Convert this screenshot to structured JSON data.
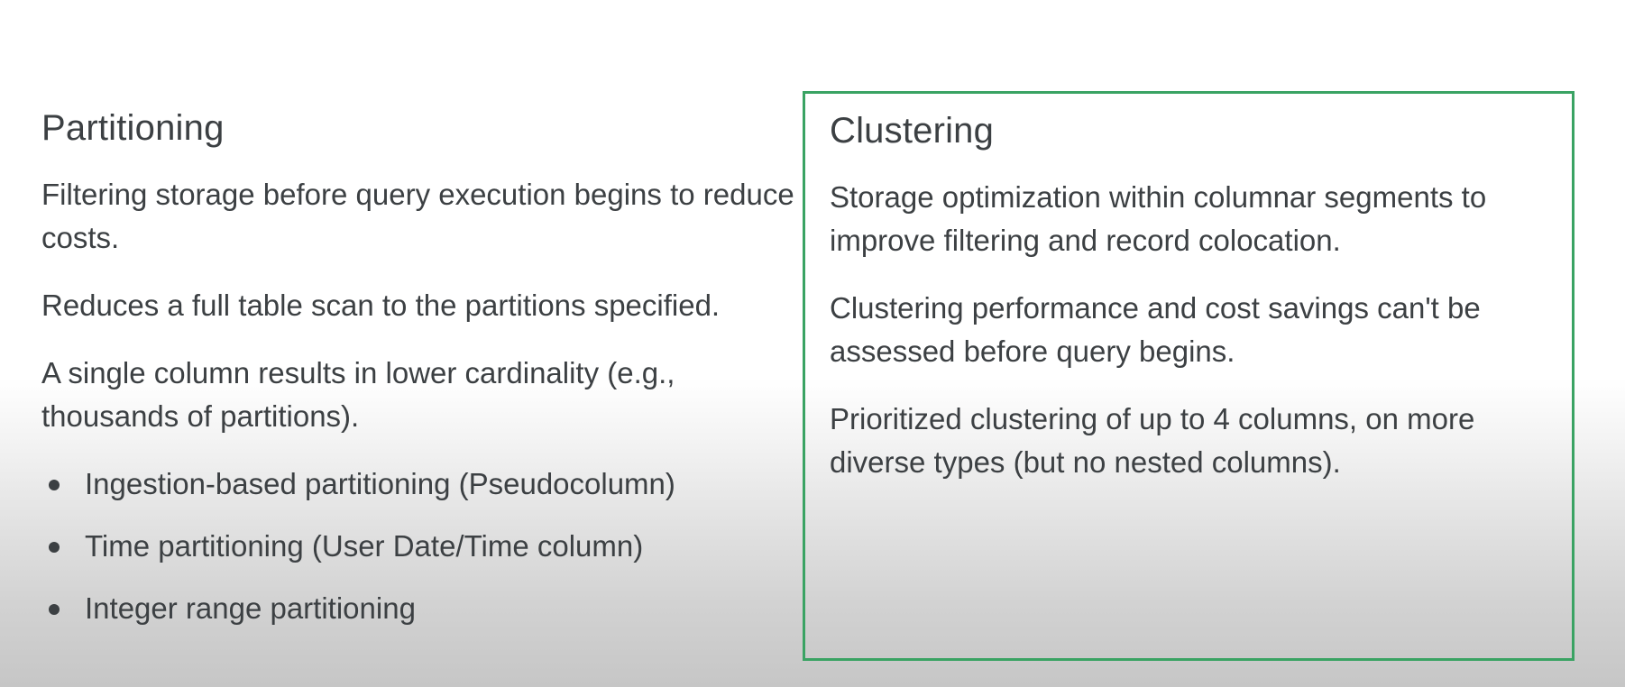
{
  "partitioning": {
    "title": "Partitioning",
    "paragraphs": [
      "Filtering storage before query execution begins to reduce costs.",
      "Reduces a full table scan to the partitions specified.",
      "A single column results in lower cardinality (e.g., thousands of partitions)."
    ],
    "bullets": [
      "Ingestion-based partitioning (Pseudocolumn)",
      "Time partitioning (User Date/Time column)",
      "Integer range partitioning"
    ]
  },
  "clustering": {
    "title": "Clustering",
    "paragraphs": [
      "Storage optimization within columnar segments to improve filtering and record colocation.",
      "Clustering performance and cost savings can't be assessed before query begins.",
      "Prioritized clustering of up to 4 columns, on more diverse types (but no nested columns)."
    ]
  },
  "colors": {
    "text": "#3c4043",
    "highlight_border": "#3aa363"
  }
}
